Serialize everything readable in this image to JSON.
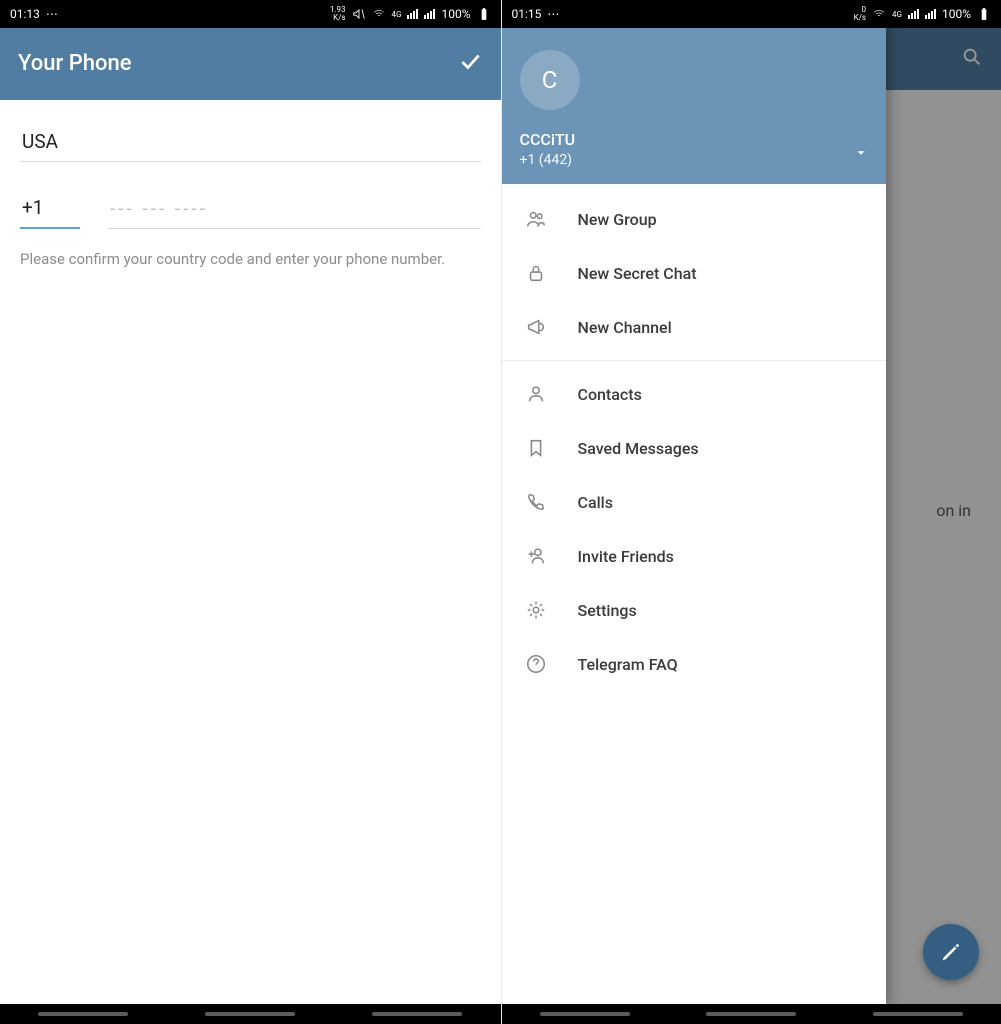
{
  "left": {
    "status": {
      "time": "01:13",
      "speed": "1.93",
      "unit": "K/s",
      "net": "4G",
      "battery": "100%"
    },
    "title": "Your Phone",
    "country": "USA",
    "code": "+1",
    "num_placeholder": "--- --- ----",
    "hint": "Please confirm your country code and enter your phone number."
  },
  "right": {
    "status": {
      "time": "01:15",
      "speed": "0",
      "unit": "K/s",
      "net": "4G",
      "battery": "100%"
    },
    "bg_fragment": "on in",
    "profile": {
      "initial": "C",
      "name": "CCCiTU",
      "phone": "+1 (442)"
    },
    "menu": [
      {
        "icon": "group",
        "label": "New Group"
      },
      {
        "icon": "lock",
        "label": "New Secret Chat"
      },
      {
        "icon": "megaphone",
        "label": "New Channel"
      }
    ],
    "menu2": [
      {
        "icon": "person",
        "label": "Contacts"
      },
      {
        "icon": "bookmark",
        "label": "Saved Messages"
      },
      {
        "icon": "phone",
        "label": "Calls"
      },
      {
        "icon": "adduser",
        "label": "Invite Friends"
      },
      {
        "icon": "gear",
        "label": "Settings"
      },
      {
        "icon": "help",
        "label": "Telegram FAQ"
      }
    ]
  }
}
